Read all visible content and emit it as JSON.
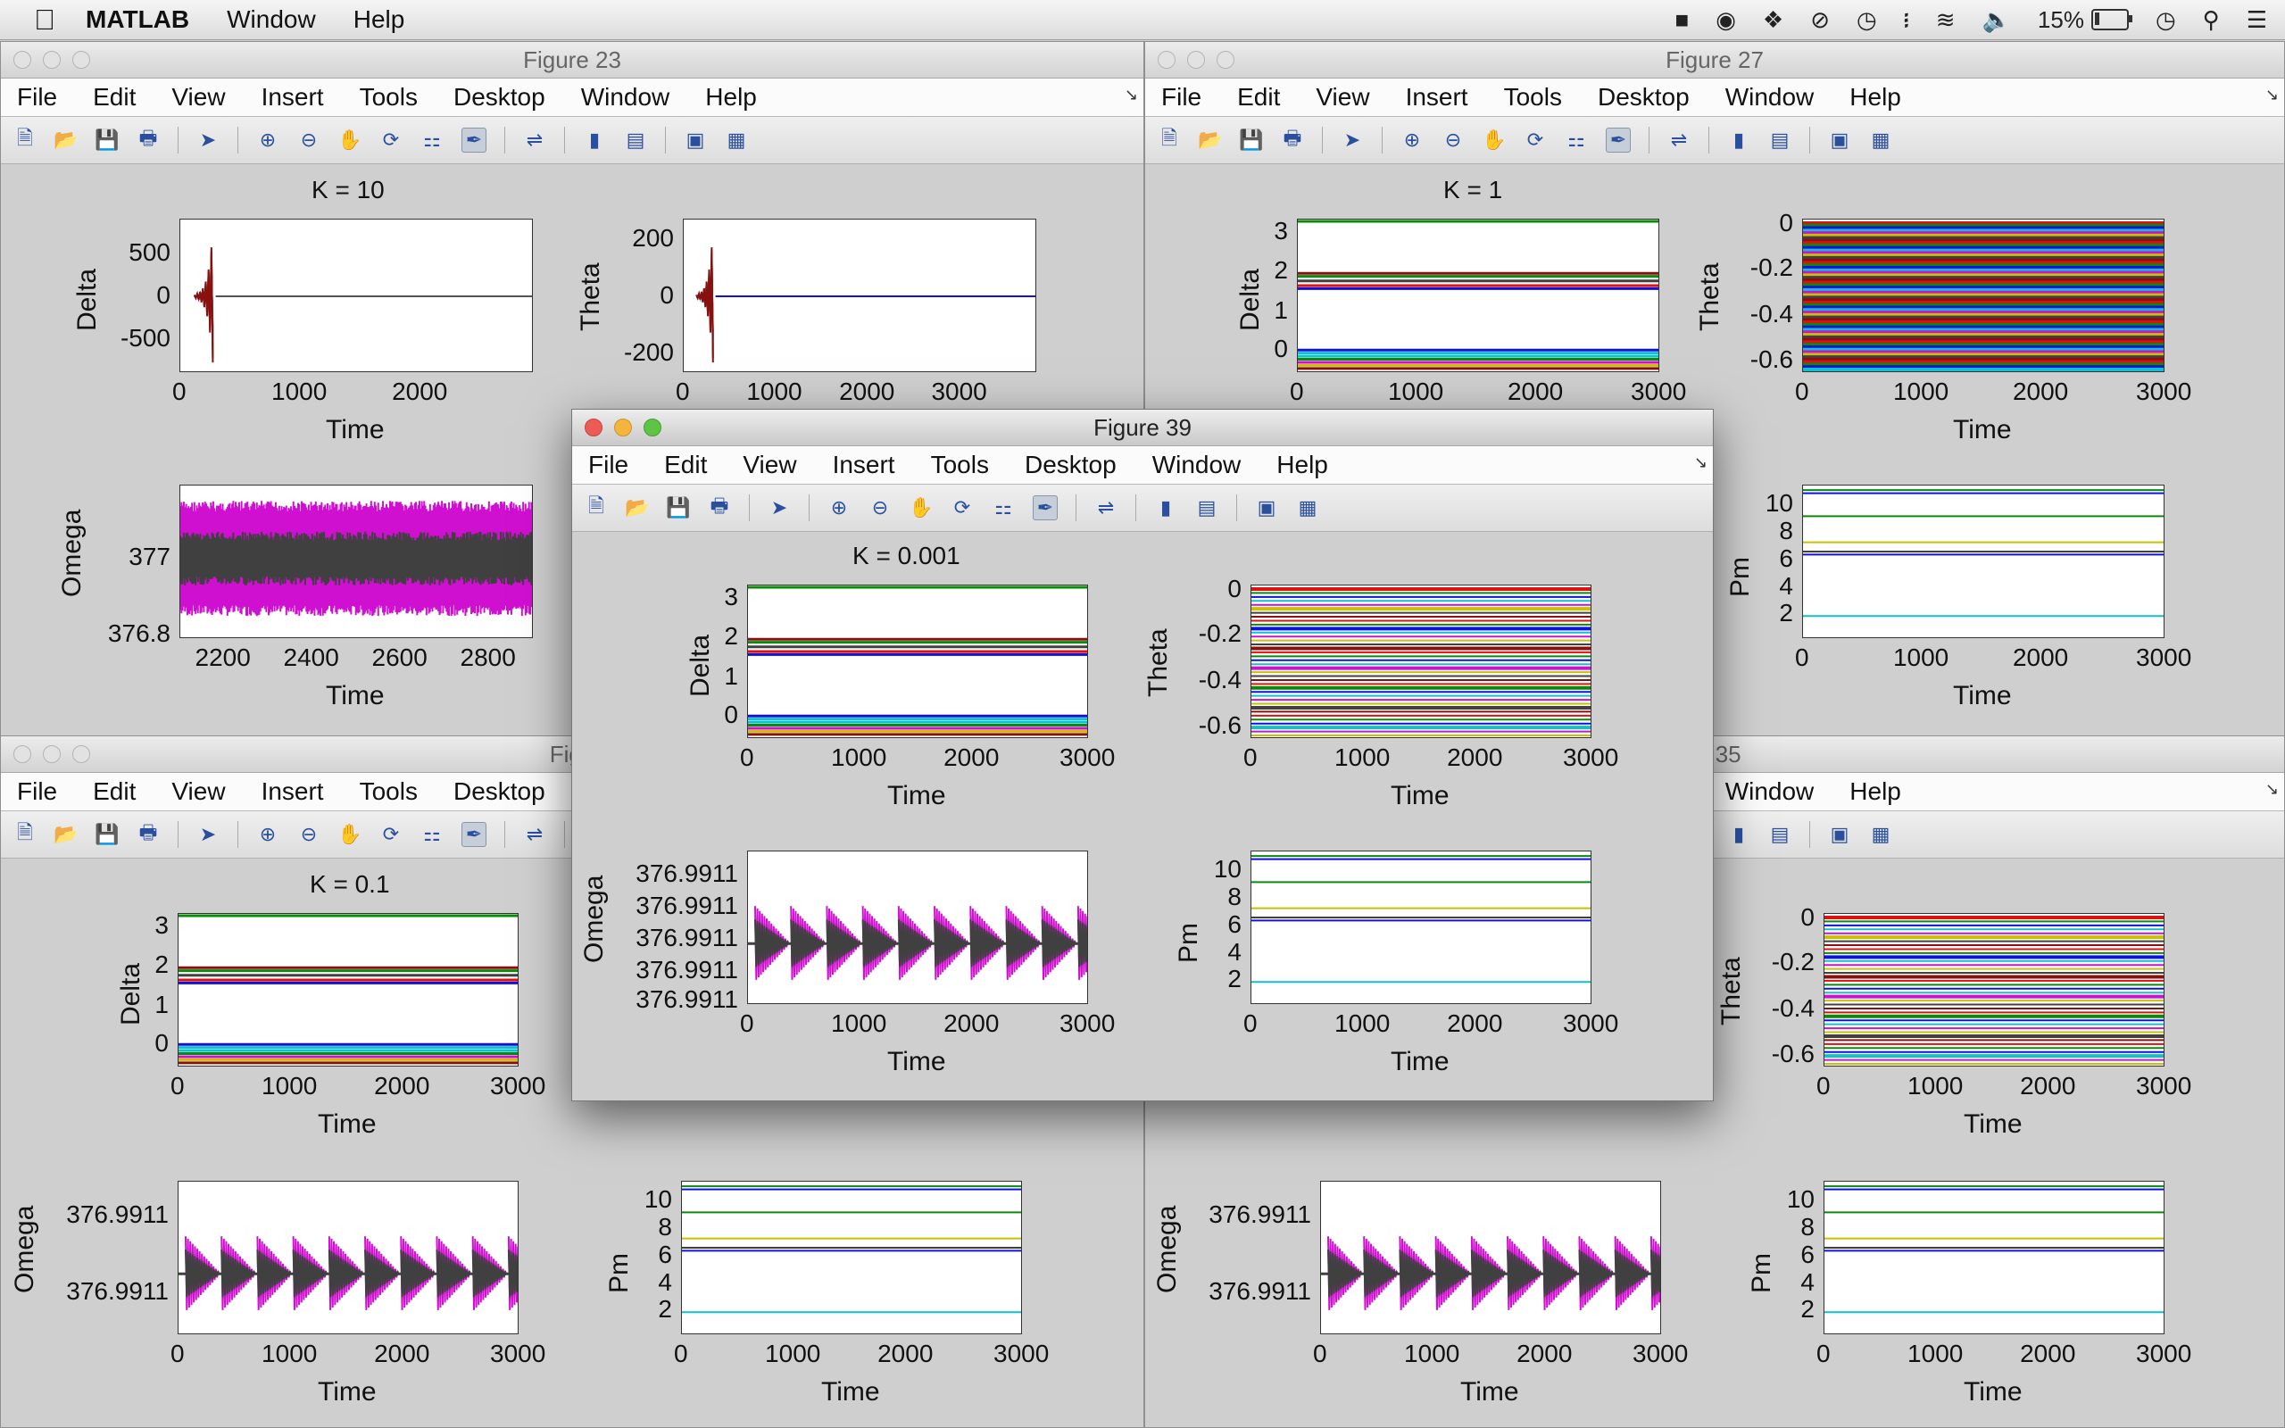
{
  "menubar": {
    "app_name": "MATLAB",
    "items": [
      "Window",
      "Help"
    ],
    "battery": "15%"
  },
  "fig_menu": [
    "File",
    "Edit",
    "View",
    "Insert",
    "Tools",
    "Desktop",
    "Window",
    "Help"
  ],
  "windows": {
    "fig23": {
      "title": "Figure 23",
      "k_label": "K = 10"
    },
    "fig27": {
      "title": "Figure 27",
      "k_label": "K = 1"
    },
    "fig39": {
      "title": "Figure 39",
      "k_label": "K = 0.001"
    },
    "figbl": {
      "title": "Figu",
      "k_label": "K = 0.1"
    },
    "figbr": {
      "title": "re 35"
    }
  },
  "axis_labels": {
    "time": "Time",
    "delta": "Delta",
    "theta": "Theta",
    "omega": "Omega",
    "pm": "Pm"
  },
  "colors": {
    "green": "#0a8a0a",
    "blue": "#1010e0",
    "red": "#e01010",
    "cyan": "#10c0d0",
    "magenta": "#d010d0",
    "yellow": "#c8c000",
    "dark": "#404040",
    "darkred": "#8a1010"
  },
  "chart_data": [
    {
      "id": "fig23-delta",
      "type": "line",
      "ylabel": "Delta",
      "xlabel": "Time",
      "xlim": [
        0,
        3000
      ],
      "xticks": [
        "0",
        "1000",
        "2000"
      ],
      "ylim": [
        -800,
        800
      ],
      "yticks": [
        "500",
        "0",
        "-500"
      ],
      "note": "oscillation growing to ±800 near t≈300 then flat 0"
    },
    {
      "id": "fig23-theta",
      "type": "line",
      "ylabel": "Theta",
      "xlabel": "Time",
      "xlim": [
        0,
        3000
      ],
      "xticks": [
        "0",
        "1000",
        "2000",
        "3000"
      ],
      "ylim": [
        -250,
        250
      ],
      "yticks": [
        "200",
        "0",
        "-200"
      ]
    },
    {
      "id": "fig23-omega",
      "type": "line",
      "ylabel": "Omega",
      "xlabel": "Time",
      "xlim": [
        2100,
        2900
      ],
      "xticks": [
        "2200",
        "2400",
        "2600",
        "2800"
      ],
      "ylim": [
        376.8,
        377.05
      ],
      "yticks": [
        "377",
        "376.8"
      ]
    },
    {
      "id": "fig27-delta",
      "type": "line",
      "ylabel": "Delta",
      "xlabel": "Time",
      "xlim": [
        0,
        3000
      ],
      "xticks": [
        "0",
        "1000",
        "2000",
        "3000"
      ],
      "ylim": [
        -0.3,
        3.2
      ],
      "yticks": [
        "3",
        "2",
        "1",
        "0"
      ]
    },
    {
      "id": "fig27-theta",
      "type": "line",
      "ylabel": "Theta",
      "xlabel": "Time",
      "xlim": [
        0,
        3000
      ],
      "xticks": [
        "0",
        "1000",
        "2000",
        "3000"
      ],
      "ylim": [
        -0.65,
        0.02
      ],
      "yticks": [
        "0",
        "-0.2",
        "-0.4",
        "-0.6"
      ]
    },
    {
      "id": "fig27-pm",
      "type": "line",
      "ylabel": "Pm",
      "xlabel": "Time",
      "xlim": [
        0,
        3000
      ],
      "xticks": [
        "0",
        "1000",
        "2000",
        "3000"
      ],
      "ylim": [
        0.5,
        11.5
      ],
      "yticks": [
        "10",
        "8",
        "6",
        "4",
        "2"
      ]
    },
    {
      "id": "fig39-delta",
      "type": "line",
      "ylabel": "Delta",
      "xlabel": "Time",
      "xlim": [
        0,
        3000
      ],
      "xticks": [
        "0",
        "1000",
        "2000",
        "3000"
      ],
      "ylim": [
        -0.3,
        3.2
      ],
      "yticks": [
        "3",
        "2",
        "1",
        "0"
      ]
    },
    {
      "id": "fig39-theta",
      "type": "line",
      "ylabel": "Theta",
      "xlabel": "Time",
      "xlim": [
        0,
        3000
      ],
      "xticks": [
        "0",
        "1000",
        "2000",
        "3000"
      ],
      "ylim": [
        -0.65,
        0.02
      ],
      "yticks": [
        "0",
        "-0.2",
        "-0.4",
        "-0.6"
      ]
    },
    {
      "id": "fig39-omega",
      "type": "line",
      "ylabel": "Omega",
      "xlabel": "Time",
      "xlim": [
        0,
        3000
      ],
      "xticks": [
        "0",
        "1000",
        "2000",
        "3000"
      ],
      "yticks": [
        "376.9911",
        "376.9911",
        "376.9911",
        "376.9911",
        "376.9911"
      ]
    },
    {
      "id": "fig39-pm",
      "type": "line",
      "ylabel": "Pm",
      "xlabel": "Time",
      "xlim": [
        0,
        3000
      ],
      "xticks": [
        "0",
        "1000",
        "2000",
        "3000"
      ],
      "ylim": [
        0.5,
        11.5
      ],
      "yticks": [
        "10",
        "8",
        "6",
        "4",
        "2"
      ]
    },
    {
      "id": "figbl-delta",
      "type": "line",
      "ylabel": "Delta",
      "xlabel": "Time",
      "xlim": [
        0,
        3000
      ],
      "xticks": [
        "0",
        "1000",
        "2000",
        "3000"
      ],
      "ylim": [
        -0.3,
        3.2
      ],
      "yticks": [
        "3",
        "2",
        "1",
        "0"
      ]
    },
    {
      "id": "figbl-omega",
      "type": "line",
      "ylabel": "Omega",
      "xlabel": "Time",
      "xlim": [
        0,
        3000
      ],
      "xticks": [
        "0",
        "1000",
        "2000",
        "3000"
      ],
      "yticks": [
        "376.9911",
        "376.9911"
      ]
    },
    {
      "id": "figbl-pm",
      "type": "line",
      "ylabel": "Pm",
      "xlabel": "Time",
      "xlim": [
        0,
        3000
      ],
      "xticks": [
        "0",
        "1000",
        "2000",
        "3000"
      ],
      "ylim": [
        0.5,
        11.5
      ],
      "yticks": [
        "10",
        "8",
        "6",
        "4",
        "2"
      ]
    },
    {
      "id": "figbr-theta",
      "type": "line",
      "ylabel": "Theta",
      "xlabel": "Time",
      "xlim": [
        0,
        3000
      ],
      "xticks": [
        "0",
        "1000",
        "2000",
        "3000"
      ],
      "ylim": [
        -0.65,
        0.02
      ],
      "yticks": [
        "0",
        "-0.2",
        "-0.4",
        "-0.6"
      ]
    },
    {
      "id": "figbr-omega",
      "type": "line",
      "ylabel": "Omega",
      "xlabel": "Time",
      "xlim": [
        0,
        3000
      ],
      "xticks": [
        "0",
        "1000",
        "2000",
        "3000"
      ],
      "yticks": [
        "376.9911",
        "376.9911"
      ]
    },
    {
      "id": "figbr-pm",
      "type": "line",
      "ylabel": "Pm",
      "xlabel": "Time",
      "xlim": [
        0,
        3000
      ],
      "xticks": [
        "0",
        "1000",
        "2000",
        "3000"
      ],
      "ylim": [
        0.5,
        11.5
      ],
      "yticks": [
        "10",
        "8",
        "6",
        "4",
        "2"
      ]
    }
  ]
}
